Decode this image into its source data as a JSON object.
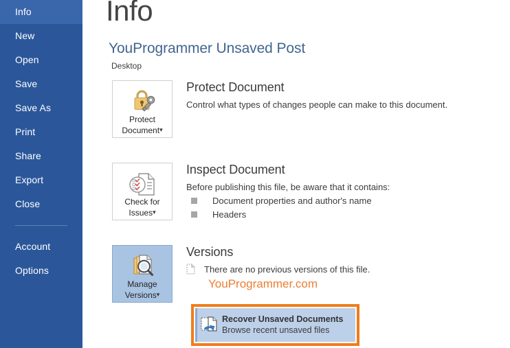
{
  "sidebar": {
    "items": [
      {
        "label": "Info",
        "selected": true
      },
      {
        "label": "New",
        "selected": false
      },
      {
        "label": "Open",
        "selected": false
      },
      {
        "label": "Save",
        "selected": false
      },
      {
        "label": "Save As",
        "selected": false
      },
      {
        "label": "Print",
        "selected": false
      },
      {
        "label": "Share",
        "selected": false
      },
      {
        "label": "Export",
        "selected": false
      },
      {
        "label": "Close",
        "selected": false
      }
    ],
    "footer_items": [
      {
        "label": "Account"
      },
      {
        "label": "Options"
      }
    ]
  },
  "header": {
    "page_title": "Info",
    "document_title": "YouProgrammer Unsaved Post",
    "document_path": "Desktop"
  },
  "sections": {
    "protect": {
      "button_label_line1": "Protect",
      "button_label_line2": "Document",
      "button_caret": "▾",
      "icon": "lock-key-icon",
      "heading": "Protect Document",
      "description": "Control what types of changes people can make to this document."
    },
    "inspect": {
      "button_label_line1": "Check for",
      "button_label_line2": "Issues",
      "button_caret": "▾",
      "icon": "document-check-icon",
      "heading": "Inspect Document",
      "description": "Before publishing this file, be aware that it contains:",
      "bullets": [
        "Document properties and author's name",
        "Headers"
      ]
    },
    "versions": {
      "button_label_line1": "Manage",
      "button_label_line2": "Versions",
      "button_caret": "▾",
      "icon": "manage-versions-icon",
      "heading": "Versions",
      "status": "There are no previous versions of this file.",
      "watermark": "YouProgrammer.com"
    }
  },
  "recover": {
    "title": "Recover Unsaved Documents",
    "subtitle": "Browse recent unsaved files",
    "icon": "recover-document-icon"
  },
  "colors": {
    "sidebar_bg": "#2b579a",
    "sidebar_selected": "#3a66ab",
    "accent_blue": "#41658f",
    "highlight_orange": "#f07d1a",
    "watermark_orange": "#ed7d31",
    "row_highlight": "#bdd0ea",
    "active_button": "#a9c3e3"
  }
}
